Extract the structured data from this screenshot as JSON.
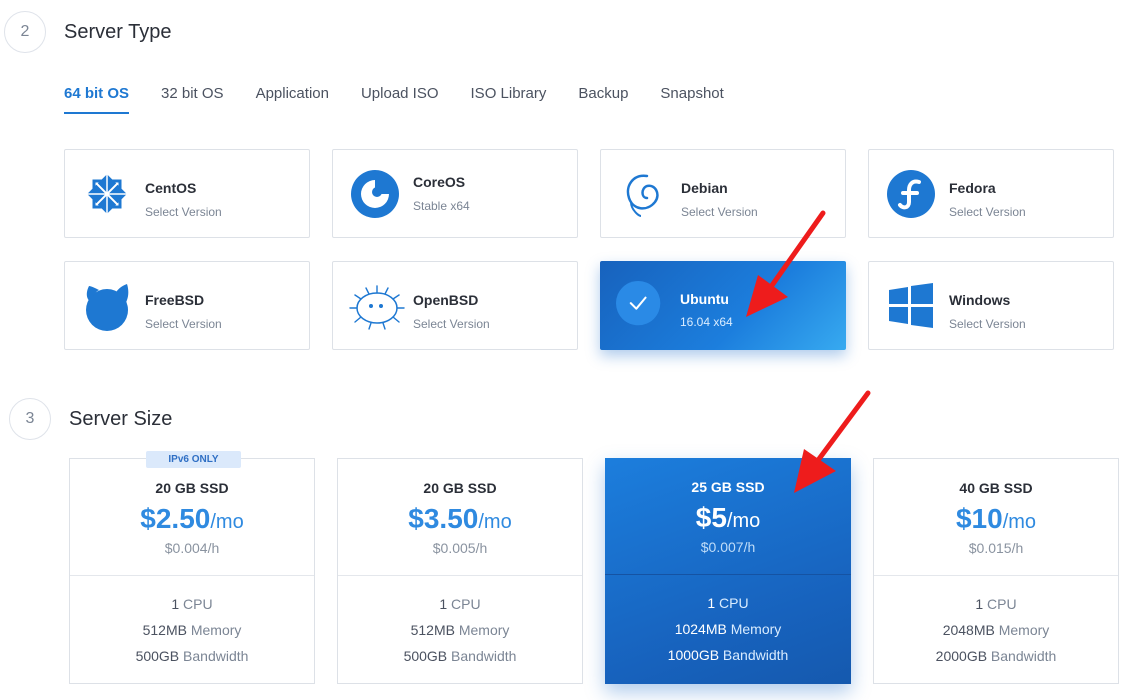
{
  "sections": {
    "server_type": {
      "number": "2",
      "title": "Server Type"
    },
    "server_size": {
      "number": "3",
      "title": "Server Size"
    }
  },
  "tabs": [
    {
      "label": "64 bit OS",
      "active": true
    },
    {
      "label": "32 bit OS"
    },
    {
      "label": "Application"
    },
    {
      "label": "Upload ISO"
    },
    {
      "label": "ISO Library"
    },
    {
      "label": "Backup"
    },
    {
      "label": "Snapshot"
    }
  ],
  "os": [
    {
      "name": "CentOS",
      "sub": "Select Version",
      "icon": "centos-logo-icon"
    },
    {
      "name": "CoreOS",
      "sub": "Stable  x64",
      "icon": "coreos-logo-icon"
    },
    {
      "name": "Debian",
      "sub": "Select Version",
      "icon": "debian-logo-icon"
    },
    {
      "name": "Fedora",
      "sub": "Select Version",
      "icon": "fedora-logo-icon"
    },
    {
      "name": "FreeBSD",
      "sub": "Select Version",
      "icon": "freebsd-logo-icon"
    },
    {
      "name": "OpenBSD",
      "sub": "Select Version",
      "icon": "openbsd-logo-icon"
    },
    {
      "name": "Ubuntu",
      "sub": "16.04  x64",
      "icon": "check-icon",
      "selected": true
    },
    {
      "name": "Windows",
      "sub": "Select Version",
      "icon": "windows-logo-icon"
    }
  ],
  "sizes": [
    {
      "badge": "IPv6 ONLY",
      "ssd": "20 GB SSD",
      "price": "$2.50",
      "per": "/mo",
      "hourly": "$0.004/h",
      "cpu": "1",
      "cpu_label": " CPU",
      "memory": "512MB",
      "memory_label": " Memory",
      "bandwidth": "500GB",
      "bandwidth_label": " Bandwidth"
    },
    {
      "ssd": "20 GB SSD",
      "price": "$3.50",
      "per": "/mo",
      "hourly": "$0.005/h",
      "cpu": "1",
      "cpu_label": " CPU",
      "memory": "512MB",
      "memory_label": " Memory",
      "bandwidth": "500GB",
      "bandwidth_label": " Bandwidth"
    },
    {
      "ssd": "25 GB SSD",
      "price": "$5",
      "per": "/mo",
      "hourly": "$0.007/h",
      "cpu": "1",
      "cpu_label": " CPU",
      "memory": "1024MB",
      "memory_label": " Memory",
      "bandwidth": "1000GB",
      "bandwidth_label": " Bandwidth",
      "selected": true
    },
    {
      "ssd": "40 GB SSD",
      "price": "$10",
      "per": "/mo",
      "hourly": "$0.015/h",
      "cpu": "1",
      "cpu_label": " CPU",
      "memory": "2048MB",
      "memory_label": " Memory",
      "bandwidth": "2000GB",
      "bandwidth_label": " Bandwidth"
    }
  ],
  "colors": {
    "accent": "#1e78d2",
    "price": "#2f8ae0",
    "annotation_arrow": "#ee1c1c"
  }
}
